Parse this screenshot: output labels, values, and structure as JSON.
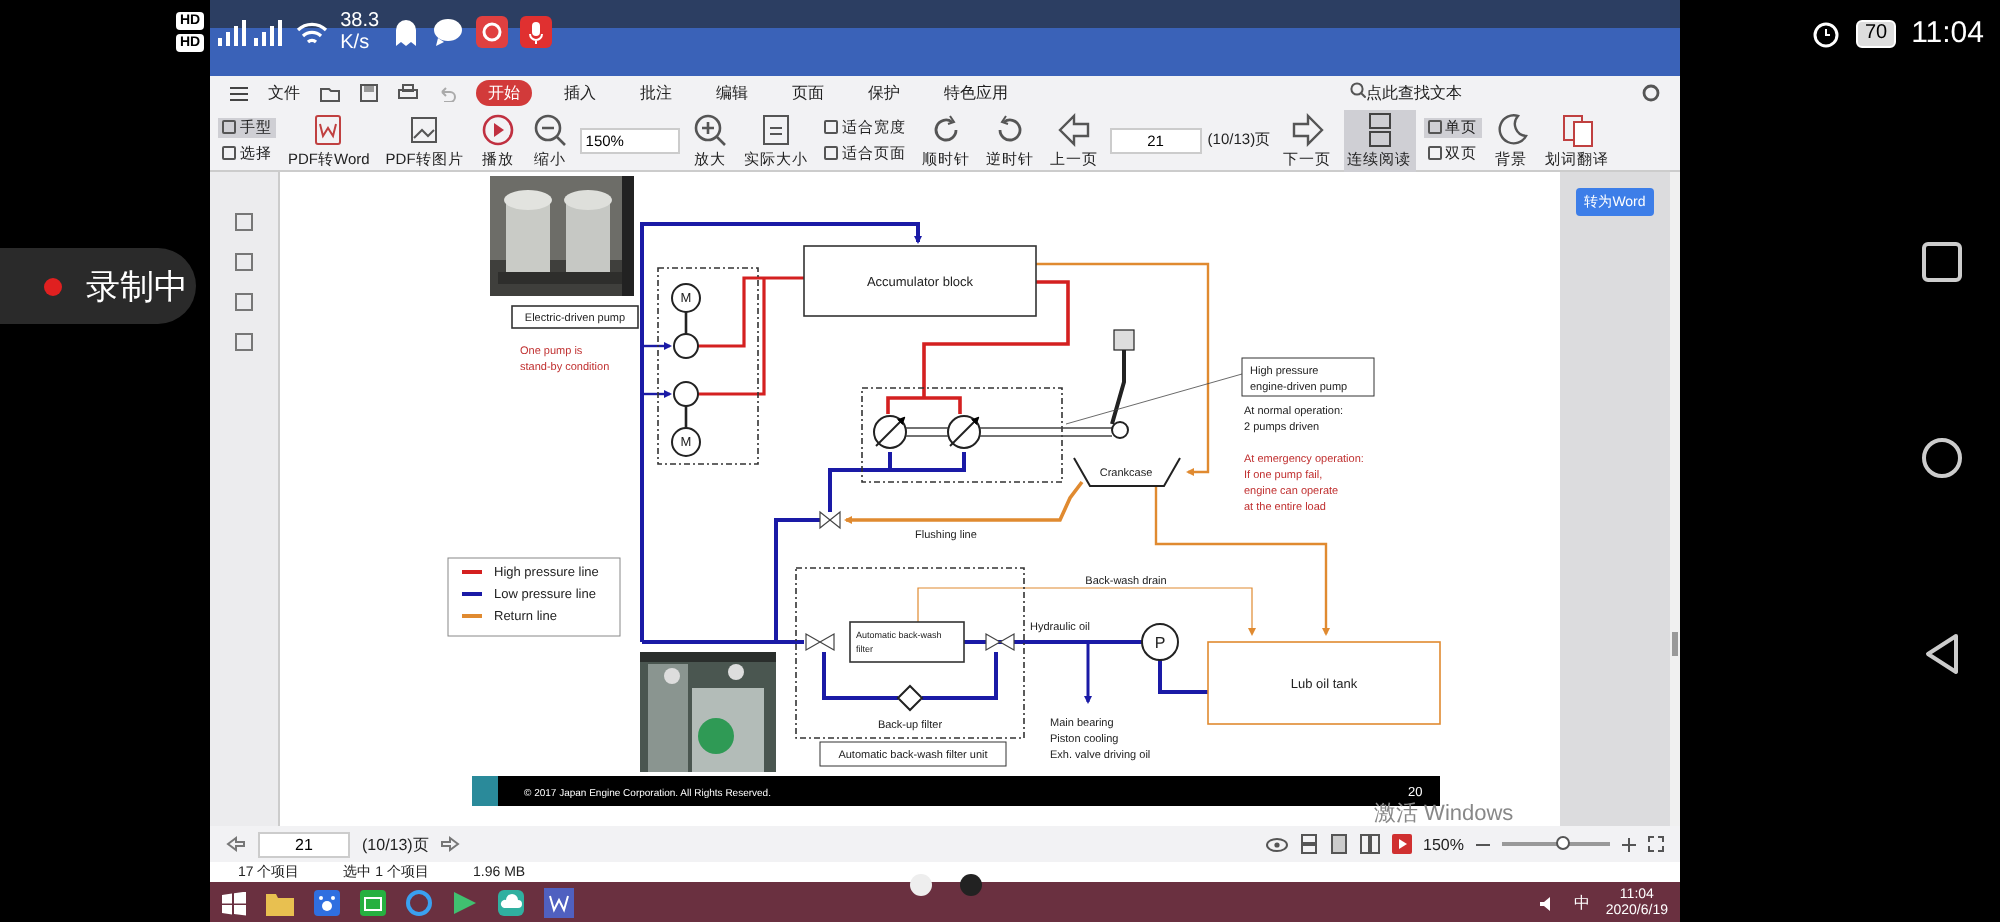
{
  "phone_status": {
    "badges": [
      "HD",
      "HD"
    ],
    "speed": "38.3",
    "speed_unit": "K/s",
    "battery": "70",
    "time": "11:04"
  },
  "recording": {
    "label": "录制中"
  },
  "menu": {
    "file": "文件",
    "search": "点此查找文本",
    "tabs": [
      {
        "label": "开始",
        "selected": true
      },
      {
        "label": "插入",
        "selected": false
      },
      {
        "label": "批注",
        "selected": false
      },
      {
        "label": "编辑",
        "selected": false
      },
      {
        "label": "页面",
        "selected": false
      },
      {
        "label": "保护",
        "selected": false
      },
      {
        "label": "特色应用",
        "selected": false
      }
    ]
  },
  "toolbar": [
    {
      "kind": "pair",
      "items": [
        {
          "label": "手型",
          "selected": true
        },
        {
          "label": "选择",
          "selected": false
        }
      ]
    },
    {
      "kind": "big",
      "label": "PDF转Word",
      "selected": false
    },
    {
      "kind": "big",
      "label": "PDF转图片",
      "selected": false
    },
    {
      "kind": "big",
      "label": "播放",
      "selected": false
    },
    {
      "kind": "big",
      "label": "缩小",
      "selected": false
    },
    {
      "kind": "zoom",
      "value": "150%"
    },
    {
      "kind": "big",
      "label": "放大",
      "selected": false
    },
    {
      "kind": "big",
      "label": "实际大小",
      "selected": false
    },
    {
      "kind": "pair",
      "items": [
        {
          "label": "适合宽度",
          "selected": false
        },
        {
          "label": "适合页面",
          "selected": false
        }
      ]
    },
    {
      "kind": "big",
      "label": "顺时针",
      "selected": false
    },
    {
      "kind": "big",
      "label": "逆时针",
      "selected": false
    },
    {
      "kind": "big",
      "label": "上一页",
      "selected": false
    },
    {
      "kind": "page",
      "value": "21",
      "count": "(10/13)页"
    },
    {
      "kind": "big",
      "label": "下一页",
      "selected": false
    },
    {
      "kind": "big",
      "label": "连续阅读",
      "selected": true
    },
    {
      "kind": "pair",
      "items": [
        {
          "label": "单页",
          "selected": true
        },
        {
          "label": "双页",
          "selected": false
        }
      ]
    },
    {
      "kind": "big",
      "label": "背景",
      "selected": false
    },
    {
      "kind": "big",
      "label": "划词翻译",
      "selected": false
    }
  ],
  "convert_button": "转为Word",
  "slide": {
    "accumulator": "Accumulator block",
    "photo_caption": "Electric-driven pump",
    "standby_note": [
      "One pump is",
      "stand-by condition"
    ],
    "motor_label": [
      "M",
      "M"
    ],
    "crankcase": "Crankcase",
    "flushing": "Flushing line",
    "pump_callout": [
      "High pressure",
      "engine-driven pump"
    ],
    "normal_note": [
      "At normal operation:",
      "2 pumps driven"
    ],
    "emergency_note": [
      "At emergency operation:",
      "If one pump fail,",
      "engine can operate",
      "at the entire load"
    ],
    "legend": [
      {
        "label": "High pressure line",
        "color": "#d42020"
      },
      {
        "label": "Low pressure line",
        "color": "#1a1aa6"
      },
      {
        "label": "Return line",
        "color": "#e08a30"
      }
    ],
    "backwash_drain": "Back-wash drain",
    "hydraulic_oil": "Hydraulic oil",
    "pump_symbol": "P",
    "tank": "Lub oil tank",
    "auto_filter": [
      "Automatic back-wash",
      "filter"
    ],
    "backup_filter": "Back-up filter",
    "filter_unit": "Automatic back-wash filter unit",
    "consumers": [
      "Main bearing",
      "Piston cooling",
      "Exh. valve driving oil"
    ],
    "footer": "© 2017 Japan Engine Corporation.  All Rights Reserved.",
    "page_number": "20"
  },
  "activation_notice": "激活 Windows",
  "status": {
    "page": "21",
    "count": "(10/13)页",
    "zoom": "150%",
    "zoom_slider": {
      "level": 0.55
    }
  },
  "explorer_status": [
    "17 个项目",
    "选中 1 个项目",
    "1.96 MB"
  ],
  "taskbar": {
    "ime": "中",
    "time": "11:04",
    "date": "2020/6/19"
  }
}
